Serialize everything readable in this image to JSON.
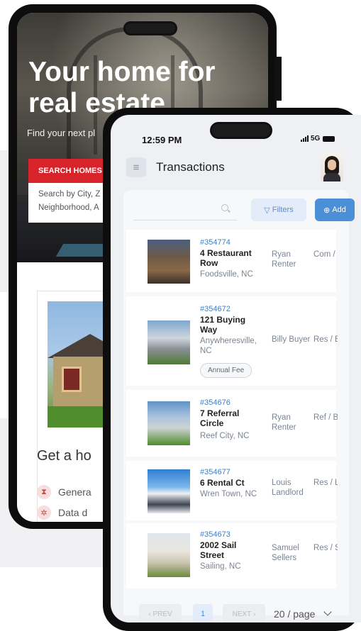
{
  "back_phone": {
    "hero_title": "Your home for real estate",
    "hero_subtitle": "Find your next pl",
    "search_button": "SEARCH HOMES",
    "search_placeholder_line1": "Search by City, Z",
    "search_placeholder_line2": "Neighborhood, A",
    "section_heading": "Get a ho",
    "features": [
      "Genera",
      "Data d"
    ]
  },
  "front_phone": {
    "status": {
      "time": "12:59 PM",
      "network": "5G"
    },
    "header": {
      "title": "Transactions"
    },
    "toolbar": {
      "filters_label": "Filters",
      "add_label": "Add"
    },
    "transactions": [
      {
        "id": "#354774",
        "address": "4 Restaurant Row",
        "city": "Foodsville, NC",
        "person": "Ryan Renter",
        "type": "Com / Tenan"
      },
      {
        "id": "#354672",
        "address": "121 Buying Way",
        "city": "Anywheresville, NC",
        "person": "Billy Buyer",
        "type": "Res / Buyer",
        "tag": "Annual Fee"
      },
      {
        "id": "#354676",
        "address": "7 Referral Circle",
        "city": "Reef City, NC",
        "person": "Ryan Renter",
        "type": "Ref / Buyer"
      },
      {
        "id": "#354677",
        "address": "6 Rental Ct",
        "city": "Wren Town, NC",
        "person": "Louis Landlord",
        "type": "Res / Landlc"
      },
      {
        "id": "#354673",
        "address": "2002 Sail Street",
        "city": "Sailing, NC",
        "person": "Samuel Sellers",
        "type": "Res / Seller"
      }
    ],
    "pagination": {
      "prev": "PREV",
      "page": "1",
      "next": "NEXT",
      "page_size": "20 / page"
    }
  },
  "colors": {
    "accent": "#4b8fd6",
    "brand_red": "#d8232a",
    "link": "#3f7fc6"
  }
}
